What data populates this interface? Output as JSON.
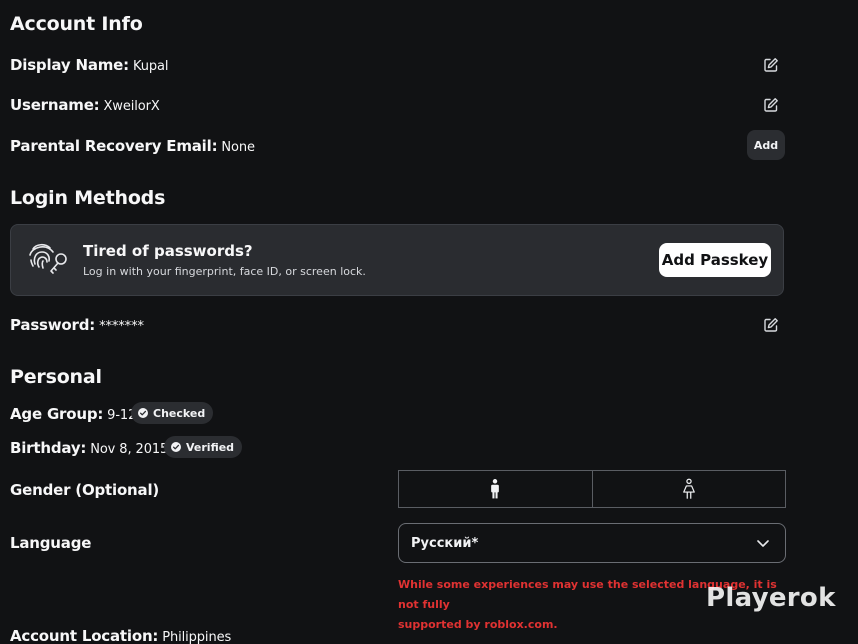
{
  "account_info": {
    "title": "Account Info",
    "display_name": {
      "label": "Display Name:",
      "value": "Kupal"
    },
    "username": {
      "label": "Username:",
      "value": "XweilorX"
    },
    "parental_email": {
      "label": "Parental Recovery Email:",
      "value": "None",
      "button": "Add"
    }
  },
  "login_methods": {
    "title": "Login Methods",
    "passkey": {
      "title": "Tired of passwords?",
      "subtitle": "Log in with your fingerprint, face ID, or screen lock.",
      "button": "Add Passkey"
    },
    "password": {
      "label": "Password:",
      "value": "*******"
    }
  },
  "personal": {
    "title": "Personal",
    "age_group": {
      "label": "Age Group:",
      "value": "9-12",
      "badge": "Checked"
    },
    "birthday": {
      "label": "Birthday:",
      "value": "Nov 8, 2015",
      "badge": "Verified"
    },
    "gender": {
      "label": "Gender (Optional)"
    },
    "language": {
      "label": "Language",
      "selected": "Русский*",
      "warning_line1": "While some experiences may use the selected language, it is not fully",
      "warning_line2": "supported by roblox.com."
    },
    "account_location": {
      "label": "Account Location:",
      "value": "Philippines"
    }
  },
  "watermark": "Playerok",
  "colors": {
    "background": "#111214",
    "card": "#2a2c30",
    "badge": "#2b2d31",
    "warning": "#e03232",
    "text": "#f2f3f5"
  }
}
